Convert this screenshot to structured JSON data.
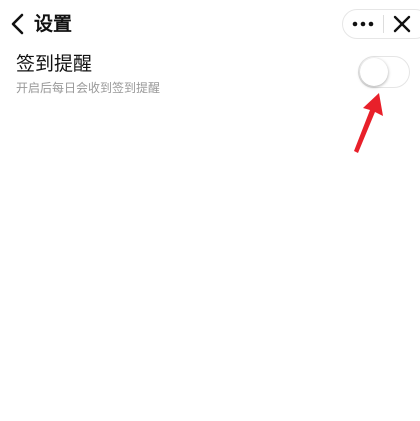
{
  "header": {
    "title": "设置",
    "back_icon": "chevron-left-icon",
    "more_icon": "more-dots-icon",
    "close_icon": "close-icon"
  },
  "setting": {
    "title": "签到提醒",
    "description": "开启后每日会收到签到提醒",
    "toggle_on": false
  },
  "annotation": {
    "arrow_color": "#e8202a"
  },
  "colors": {
    "background": "#ffffff",
    "text_primary": "#111111",
    "text_secondary": "#999999"
  }
}
